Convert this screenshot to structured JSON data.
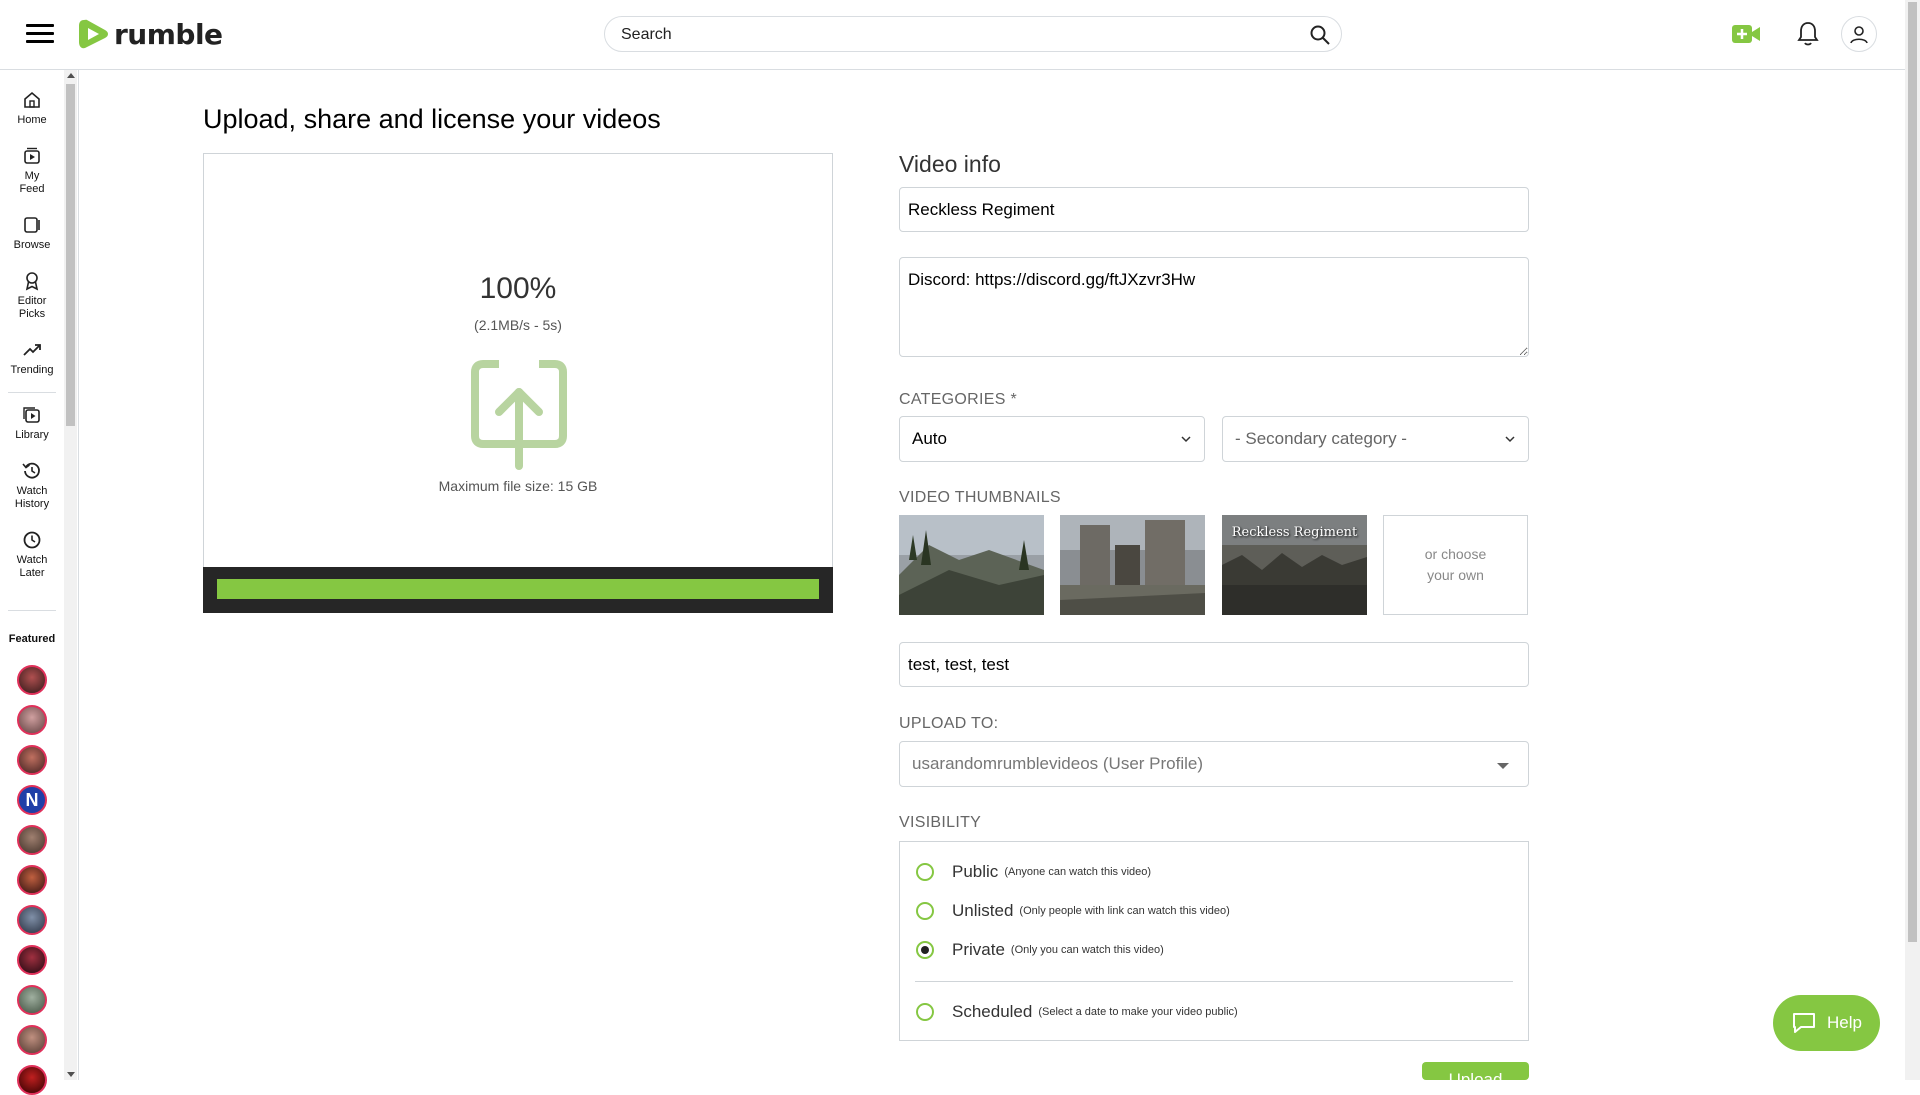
{
  "header": {
    "logo_text": "rumble",
    "search_placeholder": "Search",
    "icons": [
      "menu-icon",
      "search-icon",
      "go-live-icon",
      "bell-icon",
      "user-icon"
    ]
  },
  "sidebar": {
    "items": [
      {
        "label_lines": [
          "Home"
        ],
        "icon": "home-icon"
      },
      {
        "label_lines": [
          "My",
          "Feed"
        ],
        "icon": "feed-icon"
      },
      {
        "label_lines": [
          "Browse"
        ],
        "icon": "browse-icon"
      },
      {
        "label_lines": [
          "Editor",
          "Picks"
        ],
        "icon": "award-icon"
      },
      {
        "label_lines": [
          "Trending"
        ],
        "icon": "trending-icon"
      },
      {
        "label_lines": [
          "Library"
        ],
        "icon": "library-icon"
      },
      {
        "label_lines": [
          "Watch",
          "History"
        ],
        "icon": "history-icon"
      },
      {
        "label_lines": [
          "Watch",
          "Later"
        ],
        "icon": "clock-icon"
      }
    ],
    "featured_title": "Featured"
  },
  "main": {
    "title": "Upload, share and license your videos",
    "upload": {
      "percent": "100%",
      "speed": "(2.1MB/s - 5s)",
      "max_size": "Maximum file size: 15 GB",
      "progress": 1.0
    },
    "video_info": {
      "title": "Video info",
      "video_title_value": "Reckless Regiment",
      "description_value": "Discord: https://discord.gg/ftJXzvr3Hw",
      "categories_label": "CATEGORIES *",
      "primary_category": "Auto",
      "secondary_category": "- Secondary category -",
      "thumbnails_label": "VIDEO THUMBNAILS",
      "thumbnail_3_text": "Reckless Regiment",
      "choose_own_line1": "or choose",
      "choose_own_line2": "your own",
      "tags_value": "test, test, test",
      "upload_to_label": "UPLOAD TO:",
      "upload_to_value": "usarandomrumblevideos (User Profile)",
      "visibility_label": "VISIBILITY",
      "visibility_options": [
        {
          "label": "Public",
          "desc": "(Anyone can watch this video)",
          "checked": false
        },
        {
          "label": "Unlisted",
          "desc": "(Only people with link can watch this video)",
          "checked": false
        },
        {
          "label": "Private",
          "desc": "(Only you can watch this video)",
          "checked": true
        },
        {
          "label": "Scheduled",
          "desc": "(Select a date to make your video public)",
          "checked": false
        }
      ],
      "upload_button": "Upload"
    }
  },
  "help": {
    "label": "Help"
  },
  "colors": {
    "accent": "#85c742",
    "dark": "#262626",
    "border": "#cfd4d8"
  }
}
